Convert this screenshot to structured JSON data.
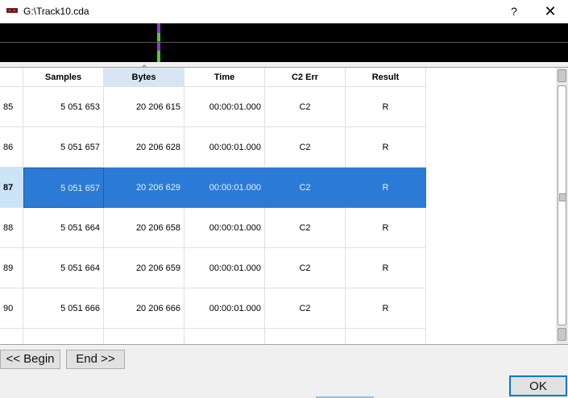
{
  "window": {
    "title": "G:\\Track10.cda",
    "help_label": "?",
    "close_label": "✕",
    "icon": "cassette-tape-icon"
  },
  "colors": {
    "selection": "#2b7bd6",
    "selected_row_header": "#cce4f7",
    "sorted_header": "#d8e6f3",
    "wave_marker_purple": "#8a3cd6",
    "wave_marker_green": "#4bd02a",
    "ok_border": "#0078d7"
  },
  "grid": {
    "columns": [
      "Samples",
      "Bytes",
      "Time",
      "C2 Err",
      "Result"
    ],
    "sorted_column": "Bytes",
    "selected_row": "87",
    "rows": [
      {
        "num": "85",
        "samples": "5 051 653",
        "bytes": "20 206 615",
        "time": "00:00:01.000",
        "c2": "C2",
        "result": "R"
      },
      {
        "num": "86",
        "samples": "5 051 657",
        "bytes": "20 206 628",
        "time": "00:00:01.000",
        "c2": "C2",
        "result": "R"
      },
      {
        "num": "87",
        "samples": "5 051 657",
        "bytes": "20 206 629",
        "time": "00:00:01.000",
        "c2": "C2",
        "result": "R"
      },
      {
        "num": "88",
        "samples": "5 051 664",
        "bytes": "20 206 658",
        "time": "00:00:01.000",
        "c2": "C2",
        "result": "R"
      },
      {
        "num": "89",
        "samples": "5 051 664",
        "bytes": "20 206 659",
        "time": "00:00:01.000",
        "c2": "C2",
        "result": "R"
      },
      {
        "num": "90",
        "samples": "5 051 666",
        "bytes": "20 206 666",
        "time": "00:00:01.000",
        "c2": "C2",
        "result": "R"
      }
    ]
  },
  "buttons": {
    "begin": "<< Begin",
    "end": "End >>",
    "ok": "OK"
  }
}
